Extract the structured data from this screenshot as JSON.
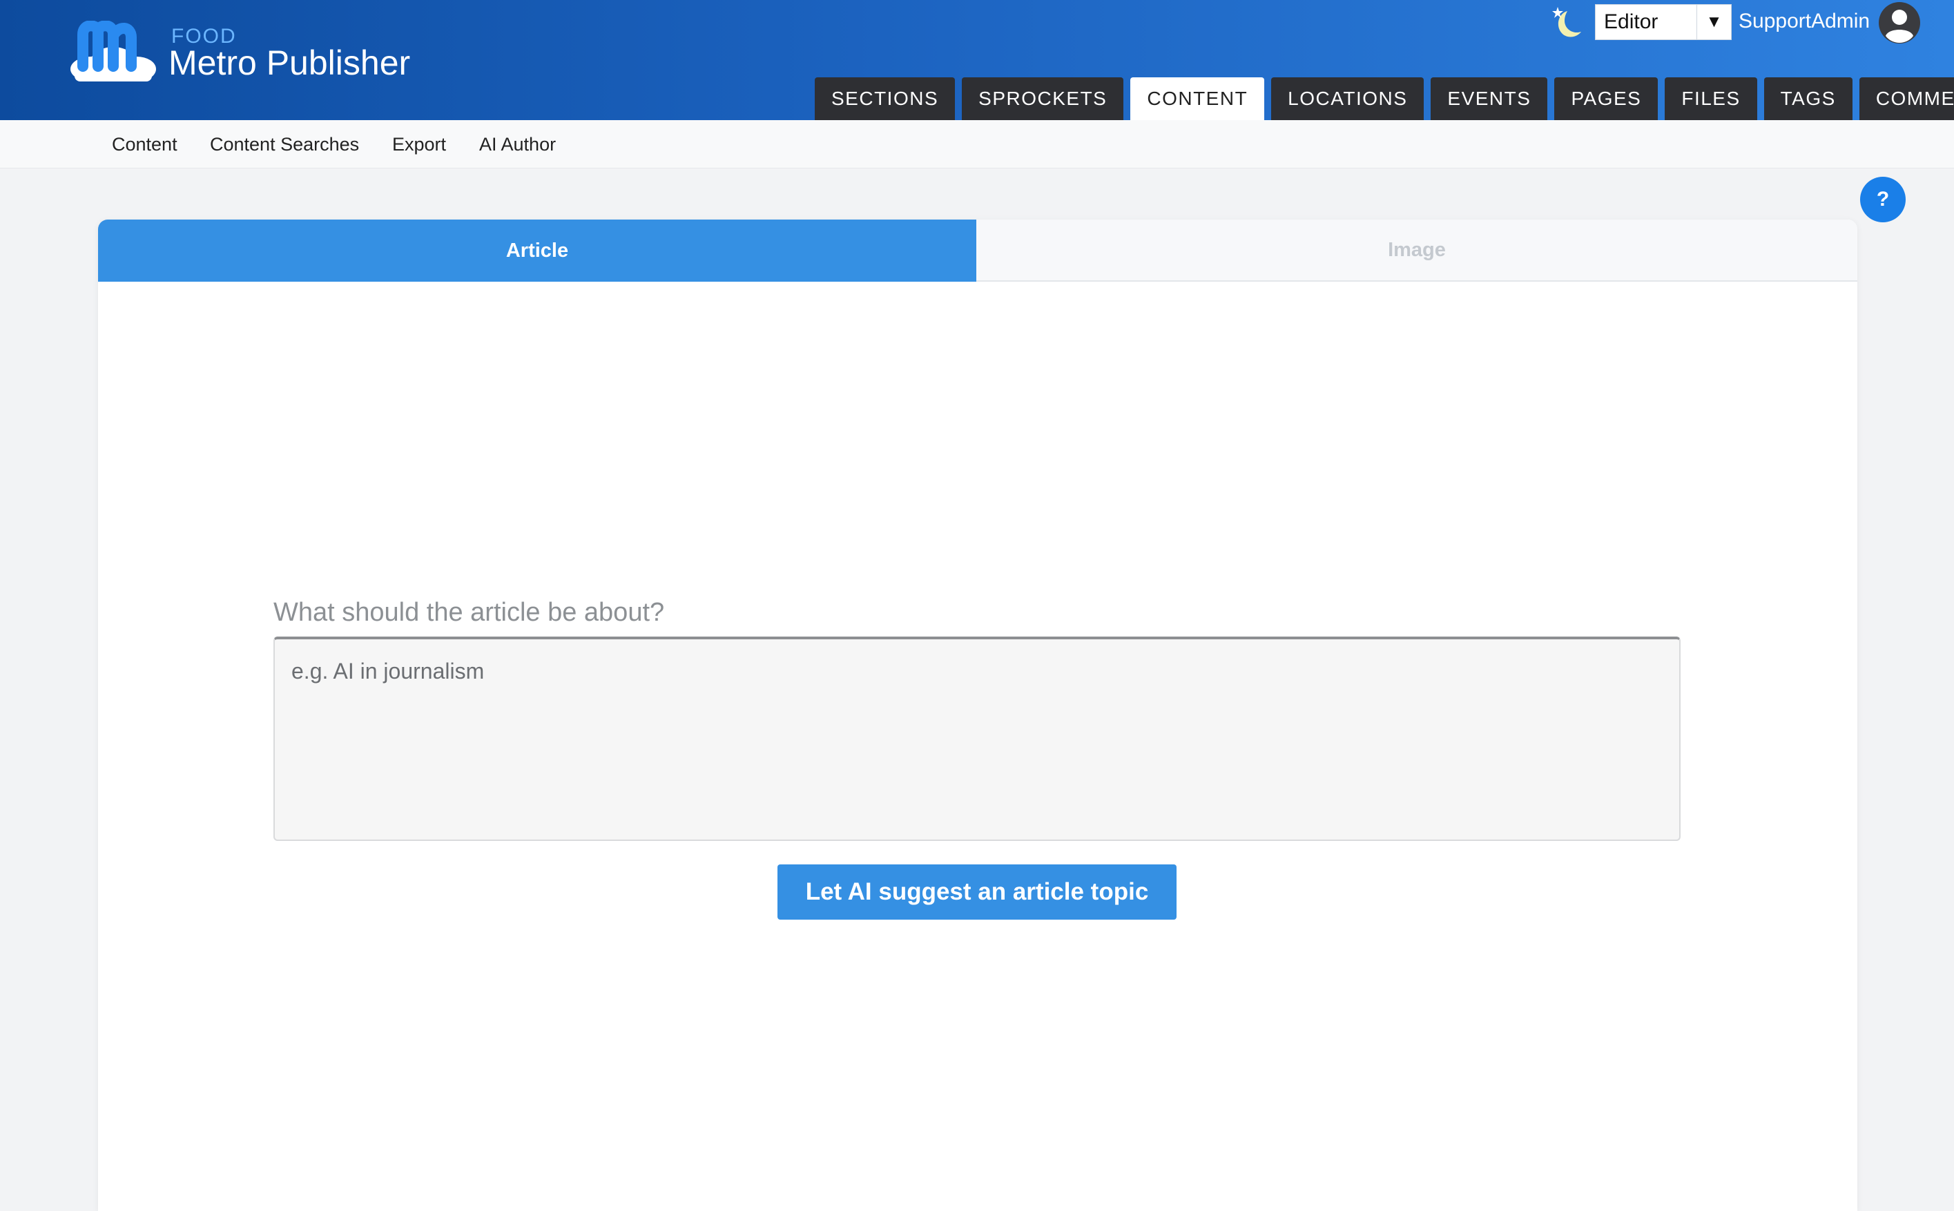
{
  "brand": {
    "site_name": "FOOD",
    "product_name": "Metro Publisher",
    "logo_icon": "metro-publisher-logo"
  },
  "header": {
    "theme_icon": "moon-star-icon",
    "role_select": {
      "value": "Editor",
      "arrow_icon": "dropdown-arrow-icon"
    },
    "username": "SupportAdmin",
    "avatar_icon": "user-avatar-icon"
  },
  "main_tabs": [
    {
      "label": "SECTIONS",
      "active": false
    },
    {
      "label": "SPROCKETS",
      "active": false
    },
    {
      "label": "CONTENT",
      "active": true
    },
    {
      "label": "LOCATIONS",
      "active": false
    },
    {
      "label": "EVENTS",
      "active": false
    },
    {
      "label": "PAGES",
      "active": false
    },
    {
      "label": "FILES",
      "active": false
    },
    {
      "label": "TAGS",
      "active": false
    },
    {
      "label": "COMMENTS",
      "active": false
    }
  ],
  "sub_nav": [
    "Content",
    "Content Searches",
    "Export",
    "AI Author"
  ],
  "help": {
    "label": "?"
  },
  "card": {
    "tabs": [
      {
        "label": "Article",
        "active": true
      },
      {
        "label": "Image",
        "active": false
      }
    ],
    "question_label": "What should the article be about?",
    "topic_input": {
      "value": "",
      "placeholder": "e.g. AI in journalism"
    },
    "suggest_button": "Let AI suggest an article topic"
  },
  "colors": {
    "header_start": "#0d4b9e",
    "header_end": "#2f82e0",
    "accent": "#3590e3",
    "tab_dark": "#2e2f33",
    "help": "#1a7fe8"
  }
}
